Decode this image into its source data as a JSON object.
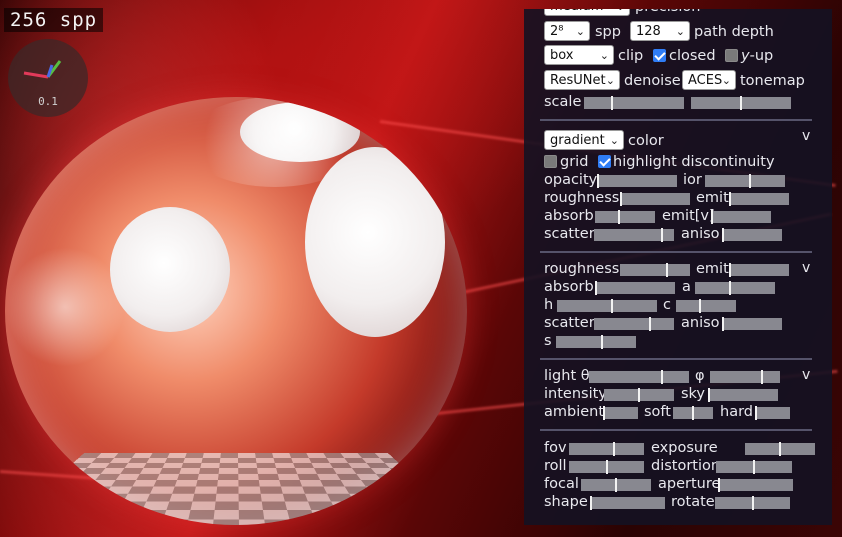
{
  "overlay": {
    "spp": "256 spp",
    "gizmo_scale": "0.1",
    "axis_colors": {
      "x": "#e23a5a",
      "y": "#58c040",
      "z": "#4a6ae6"
    }
  },
  "render": {
    "floor_pattern": "checkerboard",
    "object": "sphere"
  },
  "panel": {
    "top": {
      "precision_select": "medium",
      "precision_label": "precision",
      "spp_select": "2⁸",
      "spp_label": "spp",
      "depth_select": "128",
      "depth_label": "path depth",
      "clip_select": "box",
      "clip_label": "clip",
      "closed_label": "closed",
      "closed_checked": true,
      "yup_label_em": "y",
      "yup_label_rest": "-up",
      "yup_checked": false,
      "denoise_select": "ResUNet",
      "denoise_label": "denoise",
      "tonemap_select": "ACES",
      "tonemap_label": "tonemap",
      "scale_label": "scale",
      "scale_values": [
        0.28,
        0.5
      ]
    },
    "material": {
      "color_select": "gradient",
      "color_label": "color",
      "toggle": "v",
      "grid_label": "grid",
      "grid_checked": false,
      "highlight_label": "highlight discontinuity",
      "highlight_checked": true,
      "opacity_label": "opacity",
      "opacity_value": 0.0,
      "ior_label": "ior",
      "ior_value": 0.56,
      "roughness_label": "roughness",
      "roughness_value": 0.0,
      "emit_label": "emit",
      "emit_value": 0.0,
      "absorb_label": "absorb",
      "absorb_value": 0.4,
      "emitv_label": "emit[v]",
      "emitv_value": 0.0,
      "scatter_label": "scatter",
      "scatter_value": 0.85,
      "aniso_label": "aniso",
      "aniso_value": 0.0
    },
    "medium": {
      "toggle": "v",
      "roughness_label": "roughness",
      "roughness_value": 0.67,
      "emit_label": "emit",
      "emit_value": 0.0,
      "absorb_label": "absorb",
      "absorb_value": 0.0,
      "a_label": "a",
      "a_value": 0.44,
      "h_label": "h",
      "h_value": 0.55,
      "c_label": "c",
      "c_value": 0.4,
      "scatter_label": "scatter",
      "scatter_value": 0.7,
      "aniso_label": "aniso",
      "aniso_value": 0.0,
      "s_label": "s",
      "s_value": 0.58
    },
    "lighting": {
      "toggle": "v",
      "theta_label": "light θ",
      "theta_value": 0.73,
      "phi_label": "φ",
      "phi_value": 0.74,
      "intensity_label": "intensity",
      "intensity_value": 0.5,
      "sky_label": "sky",
      "sky_value": 0.0,
      "ambient_label": "ambient",
      "ambient_value": 0.0,
      "soft_label": "soft",
      "soft_value": 0.5,
      "hard_label": "hard",
      "hard_value": 0.0
    },
    "camera": {
      "toggle": "v",
      "fov_label": "fov",
      "fov_value": 0.6,
      "exposure_label": "exposure",
      "exposure_value": 0.5,
      "roll_label": "roll",
      "roll_value": 0.5,
      "distortion_label": "distortion",
      "distortion_value": 0.5,
      "focal_label": "focal",
      "focal_value": 0.5,
      "aperture_label": "aperture",
      "aperture_value": 0.0,
      "shape_label": "shape",
      "shape_value": 0.0,
      "rotate_label": "rotate",
      "rotate_value": 0.5
    }
  }
}
